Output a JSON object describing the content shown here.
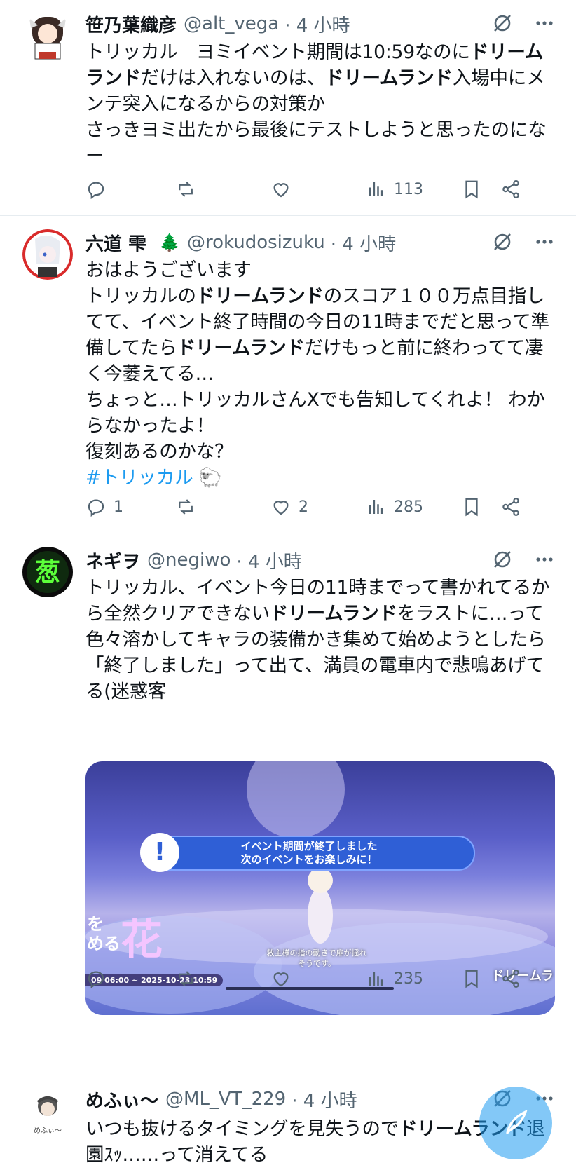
{
  "tweets": [
    {
      "name": "笹乃葉織彦",
      "handle": "@alt_vega",
      "time": "· 4 小時",
      "reply_count": "",
      "like_count": "",
      "view_count": "113"
    },
    {
      "name": "六道 雫",
      "emoji": "🌲",
      "handle": "@rokudosizuku",
      "time": "· 4 小時",
      "hashtag": "#トリッカル",
      "reply_count": "1",
      "like_count": "2",
      "view_count": "285"
    },
    {
      "name": "ネギヲ",
      "handle": "@negiwo",
      "time": "· 4 小時",
      "reply_count": "",
      "like_count": "",
      "view_count": "235",
      "media": {
        "banner_line1": "イベント期間が終了しました",
        "banner_line2": "次のイベントをお楽しみに！",
        "left_text_1": "を",
        "left_text_2": "める",
        "big_char": "花",
        "date_range": "09 06:00 ~ 2025-10-23 10:59",
        "subtitle_1": "救主様の指の動きで扉が揺れ",
        "subtitle_2": "そうです。",
        "brand": "ドリームラ"
      }
    },
    {
      "name": "めふぃ〜",
      "handle": "@ML_VT_229",
      "time": "· 4 小時",
      "avatar_text": "めふぃ～"
    }
  ],
  "colors": {
    "accent": "#1d9bf0",
    "muted": "#536471",
    "text": "#0f1419",
    "divider": "#e6ecf0"
  }
}
